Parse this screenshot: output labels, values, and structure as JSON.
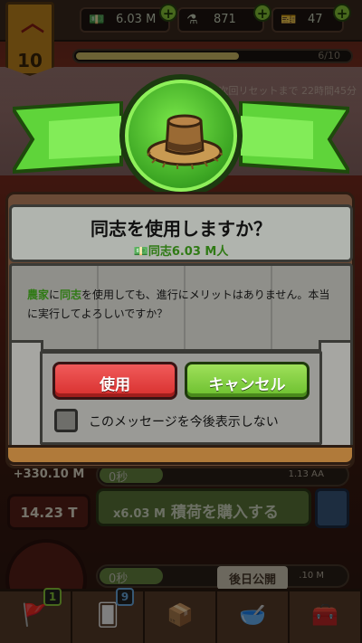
{
  "rank": {
    "level": "10"
  },
  "resources": [
    {
      "icon": "cash-icon",
      "value": "6.03 M"
    },
    {
      "icon": "flask-icon",
      "value": "871"
    },
    {
      "icon": "ticket-icon",
      "value": "47"
    }
  ],
  "xp": {
    "text": "6/10",
    "progress": 0.6
  },
  "reset_note": "次回リセットまで 22時間45分",
  "rows": {
    "income": "+330.10 M",
    "row1_time": "0秒",
    "row1_rate": "1.13 AA",
    "value_left": "14.23 T",
    "buy_label_prefix": "x6.03 M",
    "buy_label": "積荷を購入する",
    "row2_time": "0秒",
    "row2_rate": ".10 M",
    "later_badge": "後日公開"
  },
  "nav": {
    "badge1": "1",
    "badge2": "9"
  },
  "dialog": {
    "title": "同志を使用しますか？",
    "subtitle": "同志6.03 M人",
    "message_word1": "農家",
    "message_part1": "に",
    "message_word2": "同志",
    "message_part2": "を使用しても、進行にメリットはありません。本当に実行してよろしいですか？",
    "use_label": "使用",
    "cancel_label": "キャンセル",
    "dont_show_label": "このメッセージを今後表示しない",
    "dont_show_checked": false
  },
  "colors": {
    "accent_green": "#6cbf2e",
    "danger_red": "#d8302e",
    "highlight_text": "#2f7a14"
  }
}
